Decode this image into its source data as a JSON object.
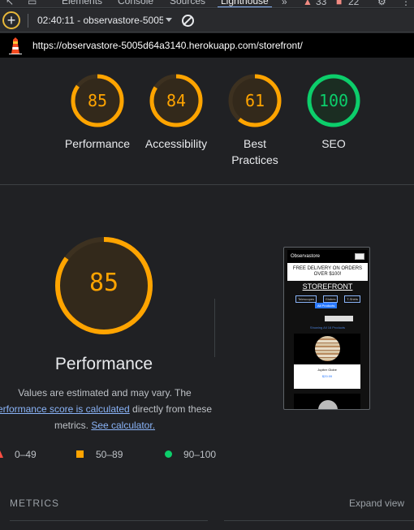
{
  "devtools": {
    "tabs": [
      "Elements",
      "Console",
      "Sources",
      "Lighthouse"
    ],
    "active_tab": "Lighthouse",
    "overflow": "»",
    "warnings_count": "33",
    "issues_count": "22"
  },
  "toolbar": {
    "report_select": "02:40:11 - observastore-5005"
  },
  "url": "https://observastore-5005d64a3140.herokuapp.com/storefront/",
  "gauges": [
    {
      "score": 85,
      "label": "Performance",
      "color": "#ffa400"
    },
    {
      "score": 84,
      "label": "Accessibility",
      "color": "#ffa400"
    },
    {
      "score": 61,
      "label": "Best\nPractices",
      "color": "#ffa400"
    },
    {
      "score": 100,
      "label": "SEO",
      "color": "#0cce6b"
    }
  ],
  "performance": {
    "score": 85,
    "title": "Performance",
    "desc_line1": "Values are estimated and may vary. The",
    "desc_link1": "erformance score is calculated",
    "desc_line2_rest": " directly from these",
    "desc_line3": "metrics. ",
    "desc_link2": "See calculator."
  },
  "legend": {
    "fail": "0–49",
    "average": "50–89",
    "pass": "90–100",
    "colors": {
      "fail": "#ff4e42",
      "average": "#ffa400",
      "pass": "#0cce6b"
    }
  },
  "thumbnail": {
    "brand": "Observastore",
    "banner": "FREE DELIVERY ON ORDERS OVER $100!",
    "title": "STOREFRONT",
    "buttons": [
      "Telescopes",
      "Globes",
      "T-Shirts"
    ],
    "all_button": "All Products",
    "note": "Showing All 16 Products",
    "card_name": "Jupiter Globe",
    "card_price": "$29.99"
  },
  "metrics": {
    "label": "METRICS",
    "expand": "Expand view"
  }
}
